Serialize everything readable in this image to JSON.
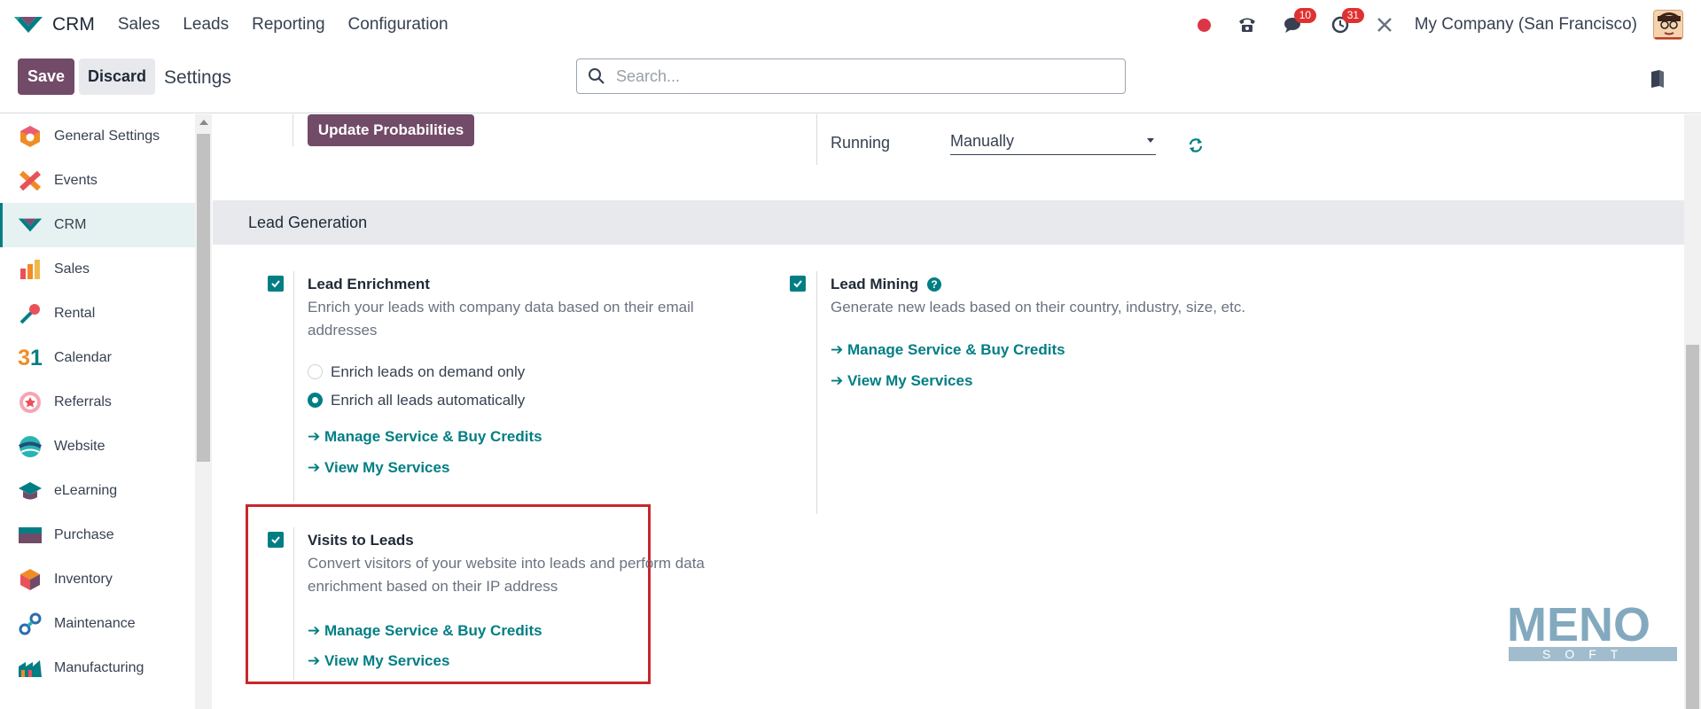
{
  "navbar": {
    "app_name": "CRM",
    "menu": [
      "Sales",
      "Leads",
      "Reporting",
      "Configuration"
    ],
    "messages_count": "10",
    "activities_count": "31",
    "company": "My Company (San Francisco)"
  },
  "controlbar": {
    "save_label": "Save",
    "discard_label": "Discard",
    "title": "Settings",
    "search_placeholder": "Search..."
  },
  "sidebar": {
    "items": [
      {
        "label": "General Settings",
        "icon": "general-settings-icon"
      },
      {
        "label": "Events",
        "icon": "events-icon"
      },
      {
        "label": "CRM",
        "icon": "crm-icon",
        "active": true
      },
      {
        "label": "Sales",
        "icon": "sales-icon"
      },
      {
        "label": "Rental",
        "icon": "rental-icon"
      },
      {
        "label": "Calendar",
        "icon": "calendar-icon"
      },
      {
        "label": "Referrals",
        "icon": "referrals-icon"
      },
      {
        "label": "Website",
        "icon": "website-icon"
      },
      {
        "label": "eLearning",
        "icon": "elearning-icon"
      },
      {
        "label": "Purchase",
        "icon": "purchase-icon"
      },
      {
        "label": "Inventory",
        "icon": "inventory-icon"
      },
      {
        "label": "Maintenance",
        "icon": "maintenance-icon"
      },
      {
        "label": "Manufacturing",
        "icon": "manufacturing-icon"
      }
    ]
  },
  "main": {
    "update_probabilities_label": "Update Probabilities",
    "running_label": "Running",
    "running_value": "Manually",
    "section_title": "Lead Generation",
    "lead_enrichment": {
      "title": "Lead Enrichment",
      "desc_line1": "Enrich your leads with company data based on their email",
      "desc_line2": "addresses",
      "option_demand": "Enrich leads on demand only",
      "option_auto": "Enrich all leads automatically",
      "link_manage": "➔ Manage Service & Buy Credits",
      "link_view": "➔ View My Services"
    },
    "lead_mining": {
      "title": "Lead Mining",
      "desc": "Generate new leads based on their country, industry, size, etc.",
      "link_manage": "➔ Manage Service & Buy Credits",
      "link_view": "➔ View My Services"
    },
    "visits_to_leads": {
      "title": "Visits to Leads",
      "desc_line1": "Convert visitors of your website into leads and perform data",
      "desc_line2": "enrichment based on their IP address",
      "link_manage": "➔ Manage Service & Buy Credits",
      "link_view": "➔ View My Services"
    }
  },
  "colors": {
    "primary": "#714b67",
    "accent": "#017e84",
    "highlight": "#c8262c"
  }
}
